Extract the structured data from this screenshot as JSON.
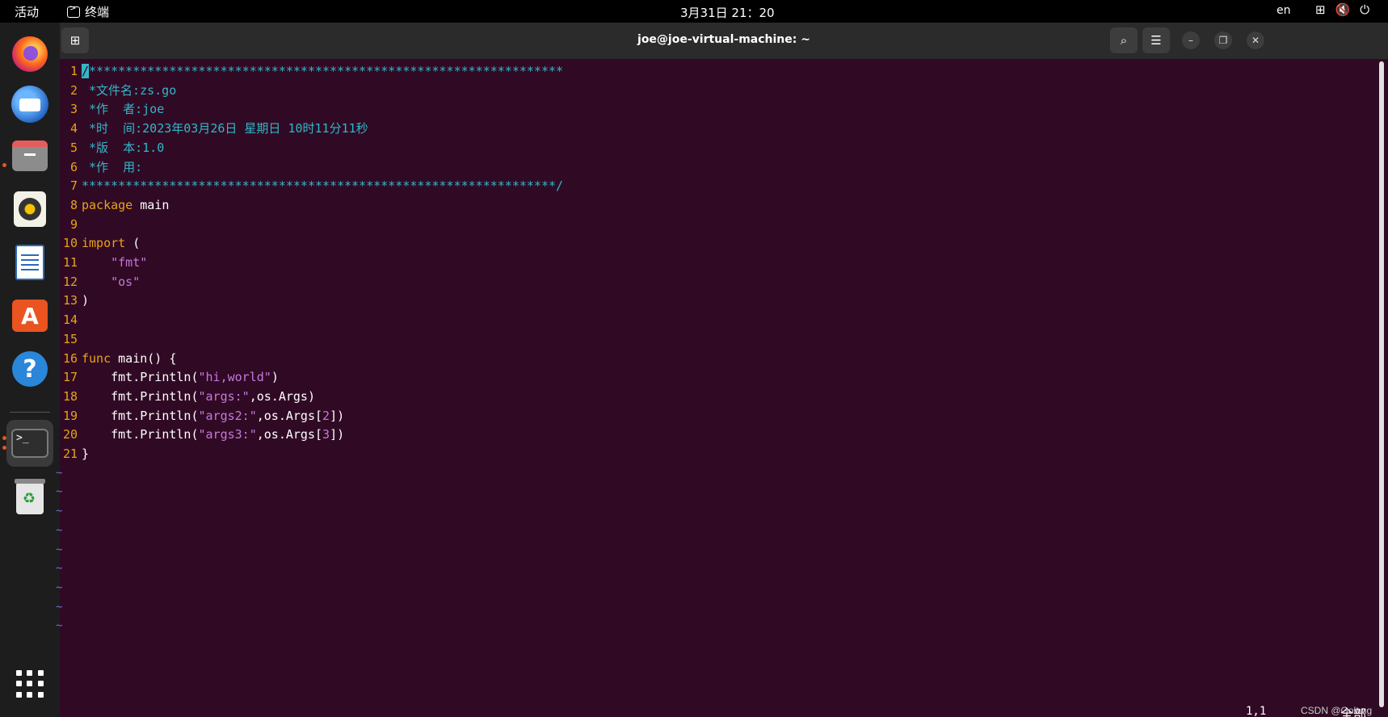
{
  "topbar": {
    "activities": "活动",
    "app_name": "终端",
    "clock": "3月31日  21：20",
    "lang": "en"
  },
  "dock": {
    "items": [
      "firefox-icon",
      "thunderbird-icon",
      "files-icon",
      "rhythmbox-icon",
      "libreoffice-writer-icon",
      "app-store-icon",
      "help-icon",
      "terminal-icon",
      "trash-icon",
      "show-apps-icon"
    ]
  },
  "window": {
    "title": "joe@joe-virtual-machine: ~"
  },
  "editor": {
    "lines": [
      {
        "n": "1",
        "text": "/*****************************************************************"
      },
      {
        "n": "2",
        "text": " *文件名:zs.go"
      },
      {
        "n": "3",
        "text": " *作  者:joe"
      },
      {
        "n": "4",
        "text": " *时  间:2023年03月26日 星期日 10时11分11秒"
      },
      {
        "n": "5",
        "text": " *版  本:1.0"
      },
      {
        "n": "6",
        "text": " *作  用:"
      },
      {
        "n": "7",
        "text": "*****************************************************************/"
      },
      {
        "n": "8",
        "kw": "package",
        "rest": " main"
      },
      {
        "n": "9"
      },
      {
        "n": "10",
        "kw": "import",
        "rest": " ("
      },
      {
        "n": "11",
        "str": "\"fmt\""
      },
      {
        "n": "12",
        "str": "\"os\""
      },
      {
        "n": "13",
        "rest": ")"
      },
      {
        "n": "14"
      },
      {
        "n": "15"
      },
      {
        "n": "16",
        "kw": "func",
        "rest": " main() {"
      },
      {
        "n": "17",
        "pre": "fmt.Println(",
        "s": "\"hi,world\"",
        "post": ")"
      },
      {
        "n": "18",
        "pre": "fmt.Println(",
        "s": "\"args:\"",
        "post": ",os.Args)"
      },
      {
        "n": "19",
        "pre": "fmt.Println(",
        "s": "\"args2:\"",
        "post": ",os.Args[",
        "num": "2",
        "post2": "])"
      },
      {
        "n": "20",
        "pre": "fmt.Println(",
        "s": "\"args3:\"",
        "post": ",os.Args[",
        "num": "3",
        "post2": "])"
      },
      {
        "n": "21",
        "rest": "}"
      }
    ],
    "tilde": "~",
    "position": "1,1",
    "scroll": "全部",
    "watermark": "CSDN @Golang"
  }
}
